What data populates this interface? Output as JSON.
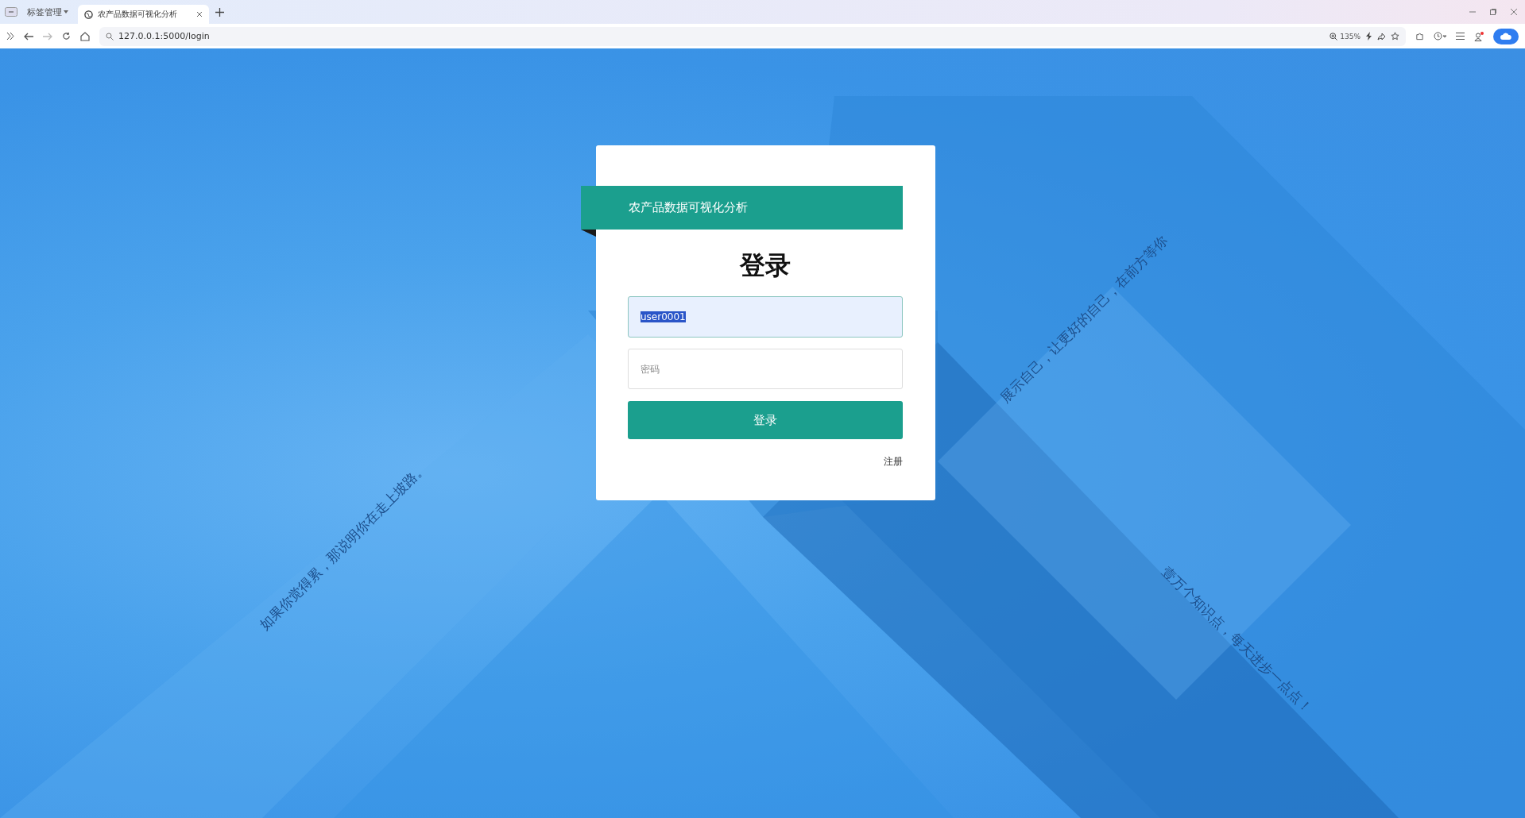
{
  "browser": {
    "tab_group": "标签管理",
    "tabs": [
      {
        "title": "农产品数据可视化分析",
        "selected": true
      }
    ],
    "address": "127.0.0.1:5000/login",
    "zoom": "135%",
    "forward_disabled": true
  },
  "login": {
    "banner": "农产品数据可视化分析",
    "heading": "登录",
    "username": {
      "value": "user0001",
      "text_selected": true
    },
    "password": {
      "placeholder": "密码"
    },
    "submit": "登录",
    "register_link": "注册"
  },
  "background_quotes": [
    {
      "text": "如果你觉得累，那说明你在走上坡路。",
      "kind": "rising"
    },
    {
      "text": "展示自己，让更好的自己，在前方等你",
      "kind": "rising"
    },
    {
      "text": "壹万个知识点，每天进步一点点！",
      "kind": "falling"
    }
  ]
}
